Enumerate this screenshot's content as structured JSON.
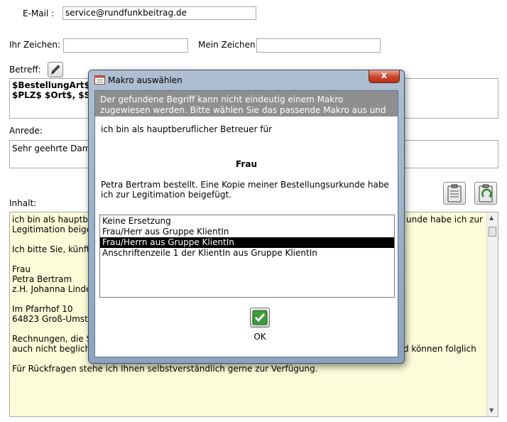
{
  "email": {
    "label": "E-Mail :",
    "value": "service@rundfunkbeitrag.de"
  },
  "ihr_zeichen": {
    "label": "Ihr Zeichen:",
    "value": ""
  },
  "mein_zeichen": {
    "label": "Mein Zeichen:",
    "value": ""
  },
  "betreff": {
    "label": "Betreff:",
    "line1": "$BestellungArt$ $",
    "line2": "$PLZ$ $Ort$, $St"
  },
  "anrede": {
    "label": "Anrede:",
    "value": "Sehr geehrte Dame"
  },
  "inhalt": {
    "label": "Inhalt:",
    "lines": [
      "ich bin als hauptberu",
      "Legitimation beigefü",
      "",
      "Ich bitte Sie, künftig",
      "",
      "Frau",
      "Petra Bertram",
      "z.H. Johanna Linden",
      "",
      "Im Pfarrhof 10",
      "64823 Groß-Umstad",
      "",
      "Rechnungen, die Sie",
      "auch nicht beglichen",
      "",
      "Für Rückfragen stehe ich Ihnen selbstverständlich gerne zur Verfügung."
    ],
    "right_line1": "unde habe ich zur",
    "right_line3": "d können folglich"
  },
  "dialog": {
    "title": "Makro auswählen",
    "close_label": "x",
    "message": "Der gefundene Begriff kann nicht eindeutig einem Makro zugewiesen werden. Bitte wählen Sie das passende Makro aus und klicken Sie OK.",
    "context_before": "ich bin als hauptberuflicher Betreuer für",
    "term": "Frau",
    "context_after": "Petra Bertram bestellt. Eine Kopie meiner Bestellungsurkunde habe ich zur Legitimation beigefügt.",
    "options": [
      "Keine Ersetzung",
      "Frau/Herr aus Gruppe KlientIn",
      "Frau/Herrn aus Gruppe KlientIn",
      "Anschriftenzeile 1 der KlientIn aus Gruppe KlientIn"
    ],
    "selected_option": "Frau/Herrn aus Gruppe KlientIn",
    "ok_label": "OK"
  },
  "colors": {
    "content_bg": "#fcfcd8",
    "selection_bg": "#000000",
    "ok_check": "#2e8b2e"
  }
}
